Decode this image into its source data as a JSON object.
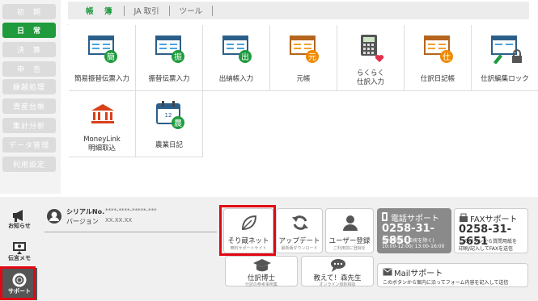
{
  "sidebar": {
    "items": [
      "初　期",
      "日　常",
      "決　算",
      "申　告",
      "繰越処理",
      "資産台帳",
      "集計分析",
      "データ管理",
      "利用設定"
    ],
    "active": "日　常"
  },
  "tabs": [
    "帳　簿",
    "JA 取引",
    "ツール"
  ],
  "ledger": {
    "items": [
      {
        "label": "簡易振替伝票入力",
        "badge": "簡",
        "color": "#1f9b3e",
        "icon": "book-icon"
      },
      {
        "label": "振替伝票入力",
        "badge": "振",
        "color": "#1f9b3e",
        "icon": "book-icon"
      },
      {
        "label": "出納帳入力",
        "badge": "出",
        "color": "#1f9b3e",
        "icon": "book-icon"
      },
      {
        "label": "元帳",
        "badge": "元",
        "color": "#f08a00",
        "icon": "book-icon"
      },
      {
        "label": "らくらく\n仕訳入力",
        "badge": "",
        "color": "#e0304a",
        "icon": "calculator-icon"
      },
      {
        "label": "仕訳日記帳",
        "badge": "仕",
        "color": "#f08a00",
        "icon": "book-icon"
      },
      {
        "label": "仕訳編集ロック",
        "badge": "",
        "color": "#1f9b3e",
        "icon": "lock-icon"
      },
      {
        "label": "MoneyLink\n明細取込",
        "badge": "",
        "color": "#d9401a",
        "icon": "bank-icon"
      },
      {
        "label": "農業日記",
        "badge": "農",
        "color": "#1f9b3e",
        "icon": "calendar-icon"
      }
    ]
  },
  "bottom": {
    "side": [
      {
        "label": "お知らせ",
        "icon": "megaphone-icon"
      },
      {
        "label": "伝言メモ",
        "icon": "memo-icon"
      },
      {
        "label": "サポート",
        "icon": "lifebuoy-icon"
      }
    ],
    "serial_label": "シリアルNo.",
    "serial_value": "****-****-*****-***",
    "version_label": "バージョン",
    "version_value": "XX.XX.XX",
    "tiles": [
      {
        "t1": "そり蔵ネット",
        "t2": "無料サポートサイト",
        "icon": "leaf-icon"
      },
      {
        "t1": "アップデート",
        "t2": "最新版ダウンロード",
        "icon": "refresh-icon"
      },
      {
        "t1": "ユーザー登録",
        "t2": "ご利用前に登録を",
        "icon": "user-icon"
      },
      {
        "t1": "仕訳博士",
        "t2": "仕訳の参考事例集",
        "icon": "graduation-icon"
      },
      {
        "t1": "教えて！森先生",
        "t2": "オンライン個別相談",
        "icon": "chat-icon"
      }
    ],
    "phone": {
      "title": "電話サポート",
      "number": "0258-31-5850",
      "hours1": "受付時間(土日祝を除く)",
      "hours2": "10:00-12:00/ 13:00-16:00"
    },
    "fax": {
      "title": "FAXサポート",
      "number": "0258-31-5651",
      "desc1": "このボタンから質問用紙を",
      "desc2": "印刷/記入してFAXを送信"
    },
    "mail": {
      "title": "Mailサポート",
      "desc": "このボタンから案内に沿ってフォーム内容を記入して送信"
    }
  }
}
